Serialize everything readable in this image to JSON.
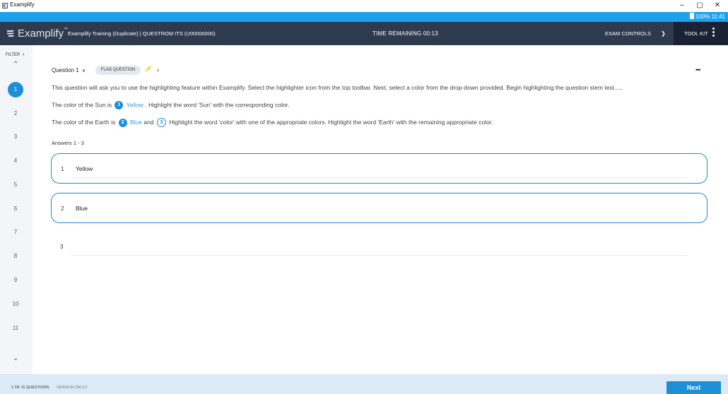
{
  "window": {
    "app_title": "Examplify",
    "minimize": "–",
    "restore": "▢",
    "close": "✕"
  },
  "statusbar": {
    "battery": "100%",
    "time": "11:41"
  },
  "header": {
    "logo_text": "Examplify",
    "logo_tm": "™",
    "exam_title": "Examplify Training (Duplicate) | QUESTROM ITS (U00000000)",
    "time_label": "TIME REMAINING",
    "time_value": "00:13",
    "exam_controls_label": "EXAM CONTROLS",
    "toolkit_label": "TOOL KIT"
  },
  "sidebar": {
    "filter_label": "FILTER",
    "questions": [
      "1",
      "2",
      "3",
      "4",
      "5",
      "6",
      "7",
      "8",
      "9",
      "10",
      "11"
    ],
    "active": "1"
  },
  "question": {
    "title": "Question 1",
    "flag_label": "FLAG QUESTION",
    "more_label": "•••",
    "instructions": "This question will ask you to use the highlighting feature within Examplify. Select the highlighter icon from the top toolbar. Next, select a color from the drop-down provided. Begin highlighting the question stem text.....",
    "line2": {
      "prefix": "The color of the Sun is",
      "badge": "1",
      "blank": "Yellow",
      "suffix": ". Highlight the word 'Sun' with the corresponding color."
    },
    "line3": {
      "prefix": "The color of the Earth is",
      "badge1": "2",
      "blank1": "Blue",
      "mid": "and",
      "badge2": "3",
      "suffix": "Highlight the word 'color' with one of the appropriate colors. Highlight the word 'Earth' with the remaining appropriate color."
    }
  },
  "answers": {
    "label": "Answers 1 - 3",
    "items": [
      {
        "num": "1",
        "value": "Yellow"
      },
      {
        "num": "2",
        "value": "Blue"
      },
      {
        "num": "3",
        "value": ""
      }
    ]
  },
  "footer": {
    "count": "1 OF 11 QUESTIONS",
    "version": "VERSION 2W.3.2",
    "next_label": "Next"
  },
  "colors": {
    "header_bg": "#2e3b4f",
    "toolkit_bg": "#1a2333",
    "accent": "#1c8fd6",
    "statusbar": "#1ea1ec",
    "footer_bg": "#dce9f6",
    "highlighter": "#f5e100"
  }
}
